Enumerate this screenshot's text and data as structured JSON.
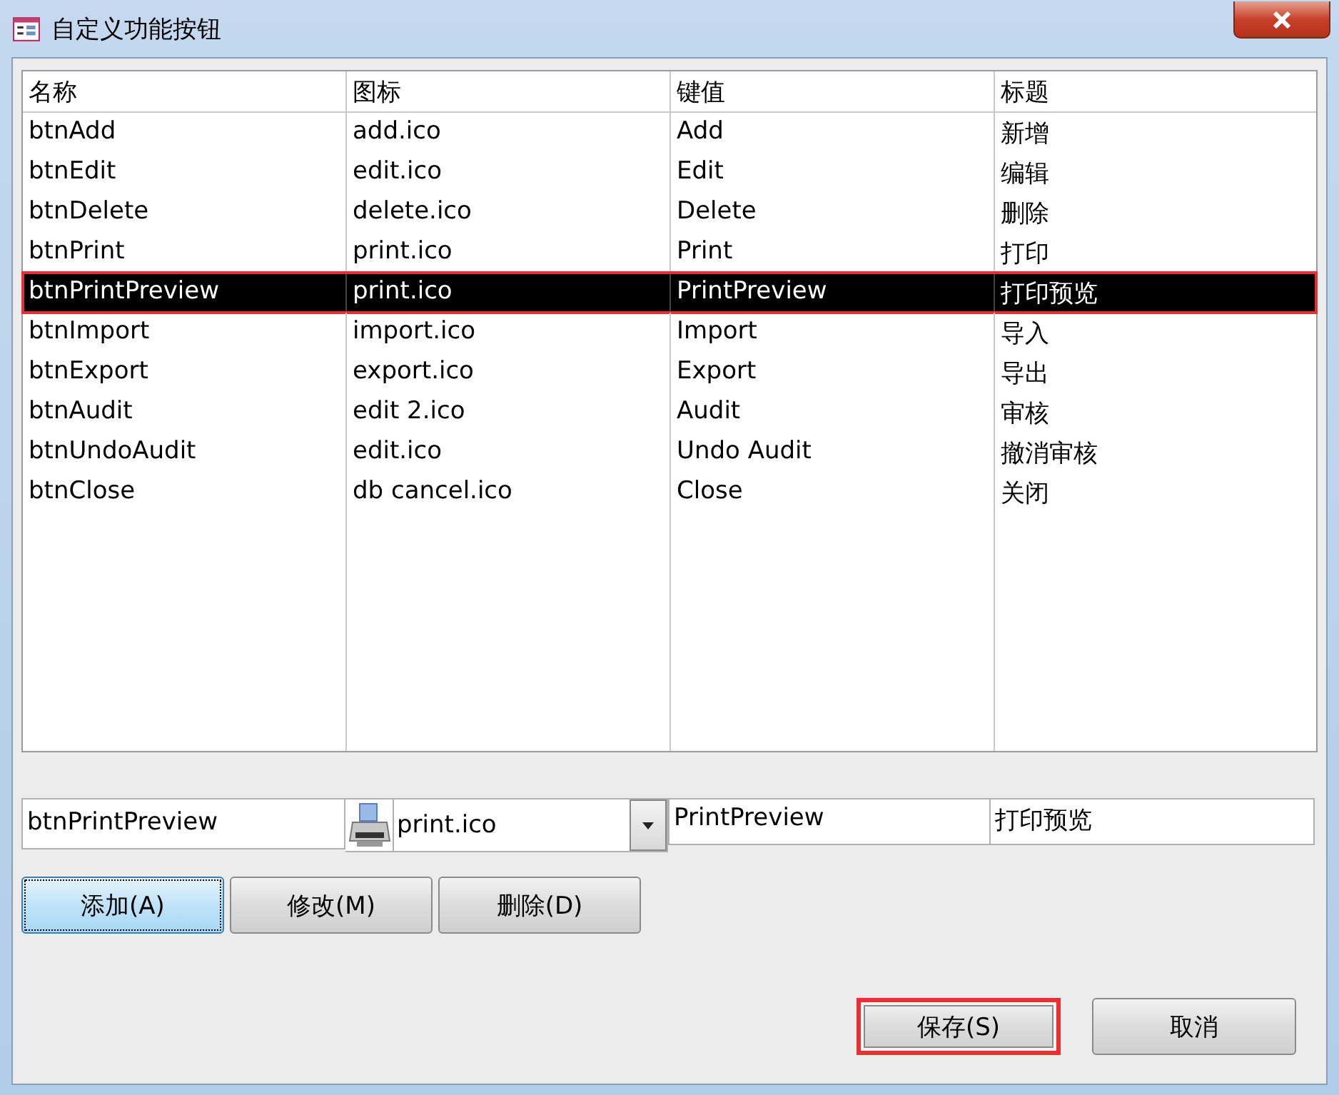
{
  "window": {
    "title": "自定义功能按钮"
  },
  "table": {
    "columns": [
      "名称",
      "图标",
      "键值",
      "标题"
    ],
    "rows": [
      {
        "cells": [
          "btnAdd",
          "add.ico",
          "Add",
          "新增"
        ],
        "selected": false,
        "highlighted": false
      },
      {
        "cells": [
          "btnEdit",
          "edit.ico",
          "Edit",
          "编辑"
        ],
        "selected": false,
        "highlighted": false
      },
      {
        "cells": [
          "btnDelete",
          "delete.ico",
          "Delete",
          "删除"
        ],
        "selected": false,
        "highlighted": false
      },
      {
        "cells": [
          "btnPrint",
          "print.ico",
          "Print",
          "打印"
        ],
        "selected": false,
        "highlighted": false
      },
      {
        "cells": [
          "btnPrintPreview",
          "print.ico",
          "PrintPreview",
          "打印预览"
        ],
        "selected": true,
        "highlighted": true
      },
      {
        "cells": [
          "btnImport",
          "import.ico",
          "Import",
          "导入"
        ],
        "selected": false,
        "highlighted": false
      },
      {
        "cells": [
          "btnExport",
          "export.ico",
          "Export",
          "导出"
        ],
        "selected": false,
        "highlighted": false
      },
      {
        "cells": [
          "btnAudit",
          "edit 2.ico",
          "Audit",
          "审核"
        ],
        "selected": false,
        "highlighted": false
      },
      {
        "cells": [
          "btnUndoAudit",
          "edit.ico",
          "Undo Audit",
          "撤消审核"
        ],
        "selected": false,
        "highlighted": false
      },
      {
        "cells": [
          "btnClose",
          "db cancel.ico",
          "Close",
          "关闭"
        ],
        "selected": false,
        "highlighted": false
      }
    ]
  },
  "editor": {
    "name": "btnPrintPreview",
    "icon": "print.ico",
    "key": "PrintPreview",
    "caption": "打印预览"
  },
  "row_buttons": [
    {
      "label": "添加(A)",
      "focused": true
    },
    {
      "label": "修改(M)",
      "focused": false
    },
    {
      "label": "删除(D)",
      "focused": false
    }
  ],
  "dialog_buttons": [
    {
      "label": "保存(S)",
      "highlighted": true
    },
    {
      "label": "取消",
      "highlighted": false
    }
  ]
}
